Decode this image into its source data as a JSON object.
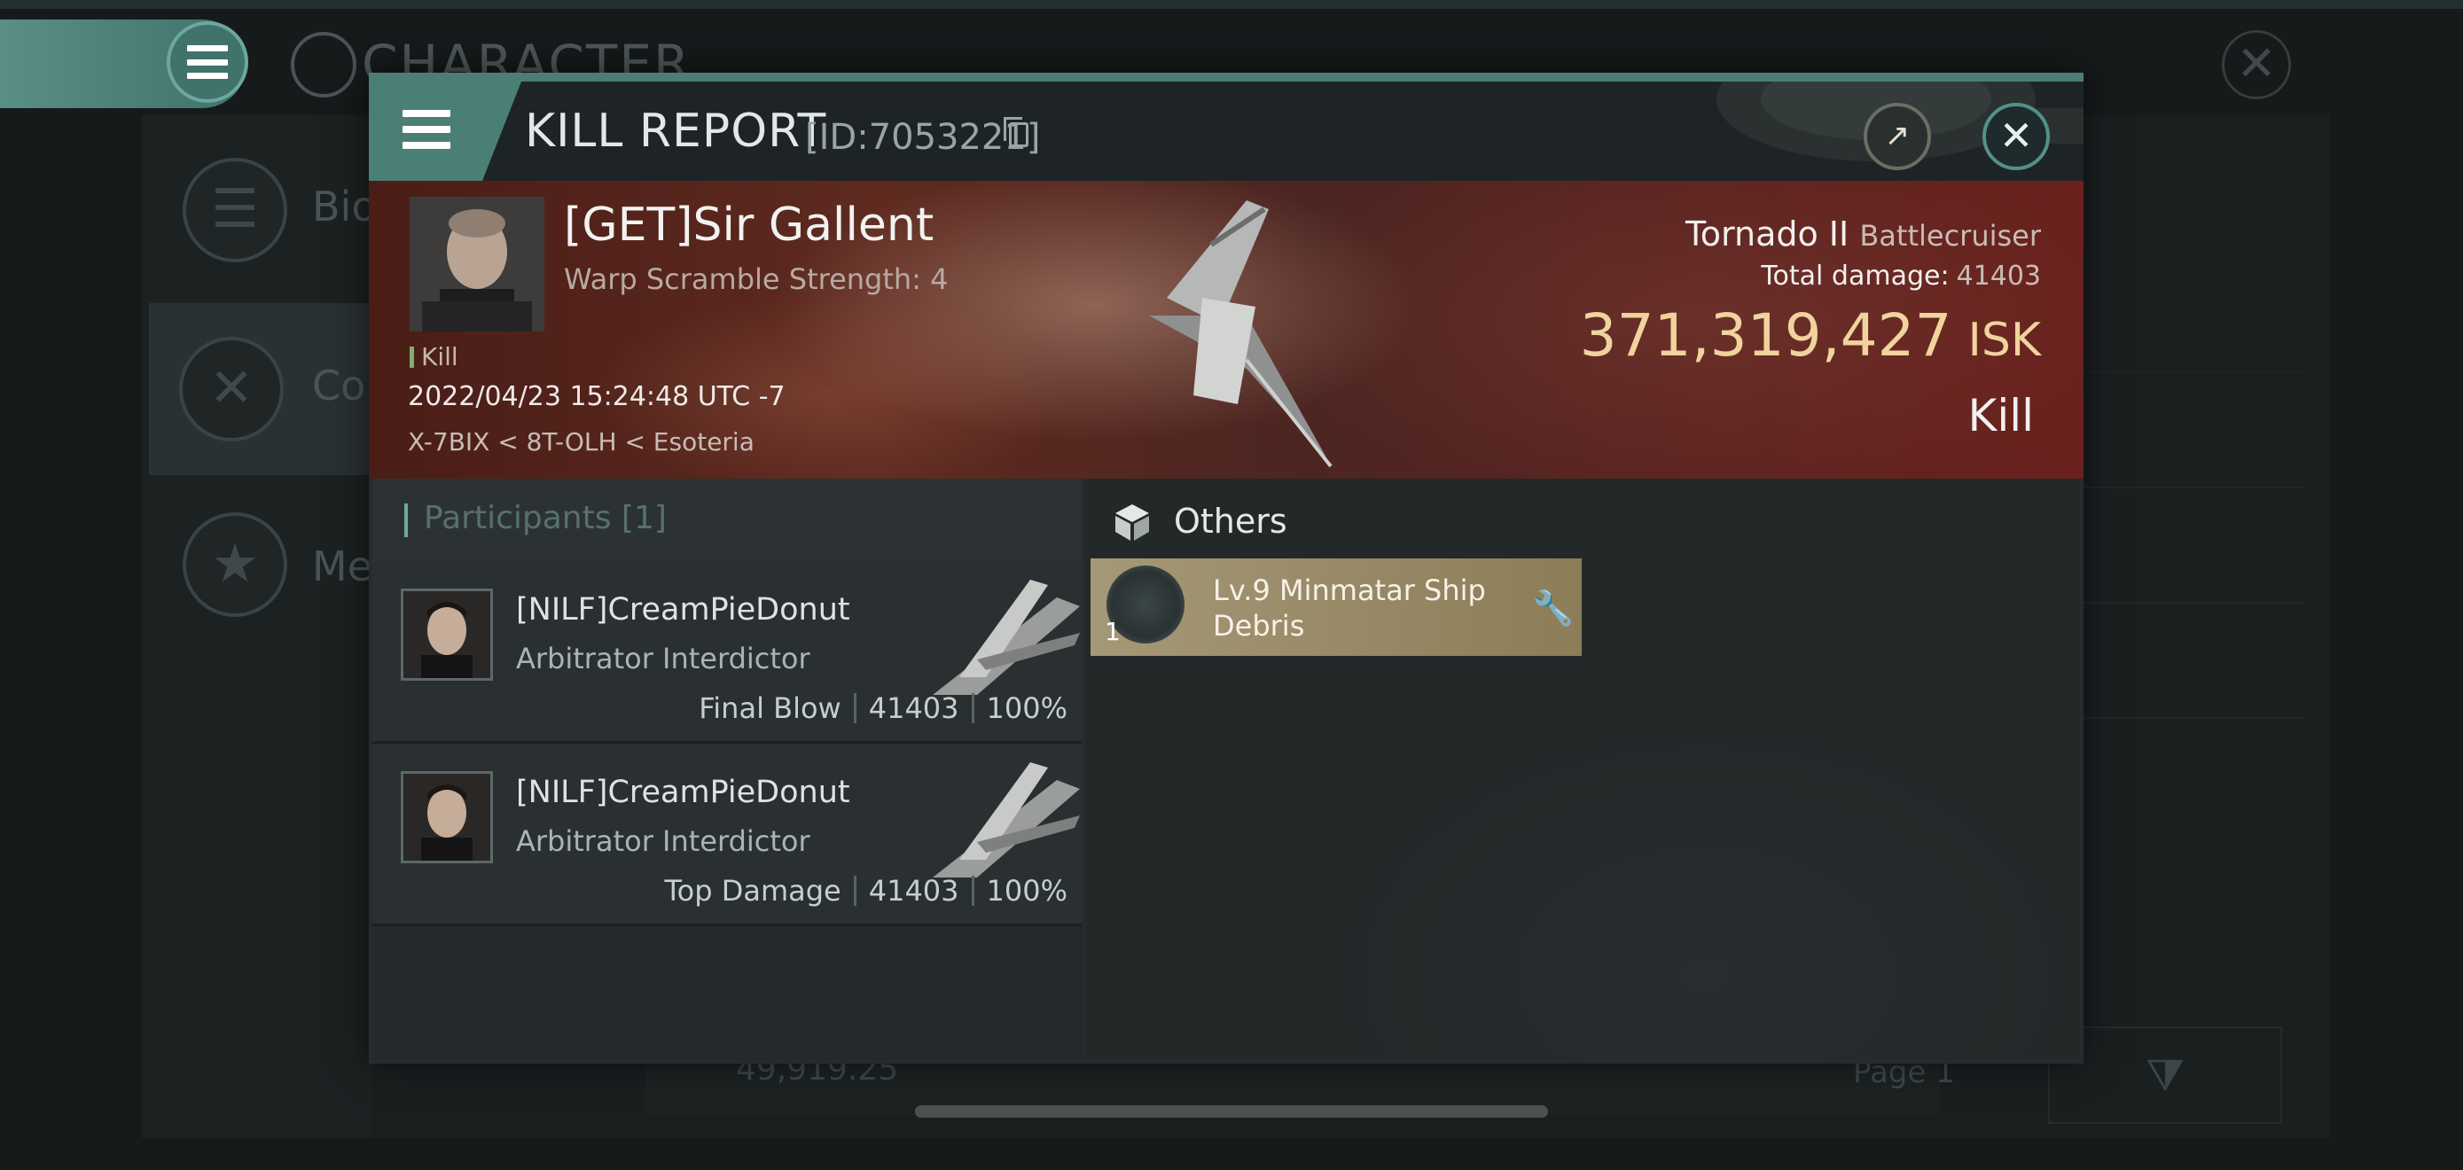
{
  "background": {
    "title": "CHARACTER",
    "sidebar_items": [
      {
        "label": "Bio",
        "icon": "list-icon"
      },
      {
        "label": "Co",
        "icon": "crossed-swords-icon"
      },
      {
        "label": "Me",
        "icon": "star-medal-icon"
      }
    ],
    "balance": "49,919.25",
    "page_label": "Page 1"
  },
  "modal": {
    "title": "KILL REPORT",
    "id_label": "[ID:7053221]",
    "victim": {
      "name": "[GET]Sir Gallent",
      "warp_scramble": "Warp Scramble Strength: 4",
      "tag": "Kill",
      "datetime": "2022/04/23 15:24:48 UTC -7",
      "location": "X-7BIX < 8T-OLH < Esoteria",
      "ship_name": "Tornado II",
      "ship_class": "Battlecruiser",
      "total_damage_label": "Total damage:",
      "total_damage_value": "41403",
      "isk_value": "371,319,427",
      "isk_unit": "ISK",
      "result": "Kill"
    },
    "participants": {
      "title": "Participants [1]",
      "rows": [
        {
          "name": "[NILF]CreamPieDonut",
          "ship": "Arbitrator Interdictor",
          "role": "Final Blow",
          "damage": "41403",
          "percent": "100%"
        },
        {
          "name": "[NILF]CreamPieDonut",
          "ship": "Arbitrator Interdictor",
          "role": "Top Damage",
          "damage": "41403",
          "percent": "100%"
        }
      ]
    },
    "others": {
      "title": "Others",
      "items": [
        {
          "name": "Lv.9 Minmatar Ship Debris",
          "count": "1"
        }
      ]
    }
  },
  "colors": {
    "accent_teal": "#4a7f76",
    "isk_gold": "#f0d39d",
    "debris_card": "#a59877",
    "wrench": "#f0b23c"
  }
}
